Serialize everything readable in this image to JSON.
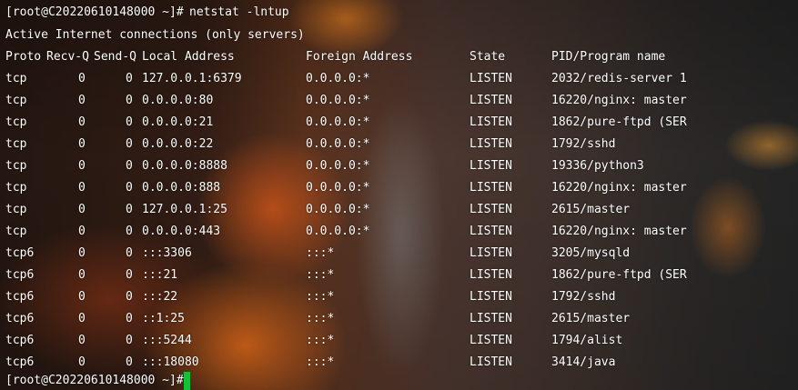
{
  "prompt": "[root@C20220610148000 ~]#",
  "command": "netstat -lntup",
  "heading": "Active Internet connections (only servers)",
  "columns": {
    "proto": "Proto",
    "recvq": "Recv-Q",
    "sendq": "Send-Q",
    "local": "Local Address",
    "foreign": "Foreign Address",
    "state": "State",
    "pid": "PID/Program name"
  },
  "rows": [
    {
      "proto": "tcp",
      "recvq": "0",
      "sendq": "0",
      "local": "127.0.0.1:6379",
      "foreign": "0.0.0.0:*",
      "state": "LISTEN",
      "pid": "2032/redis-server 1"
    },
    {
      "proto": "tcp",
      "recvq": "0",
      "sendq": "0",
      "local": "0.0.0.0:80",
      "foreign": "0.0.0.0:*",
      "state": "LISTEN",
      "pid": "16220/nginx: master"
    },
    {
      "proto": "tcp",
      "recvq": "0",
      "sendq": "0",
      "local": "0.0.0.0:21",
      "foreign": "0.0.0.0:*",
      "state": "LISTEN",
      "pid": "1862/pure-ftpd (SER"
    },
    {
      "proto": "tcp",
      "recvq": "0",
      "sendq": "0",
      "local": "0.0.0.0:22",
      "foreign": "0.0.0.0:*",
      "state": "LISTEN",
      "pid": "1792/sshd"
    },
    {
      "proto": "tcp",
      "recvq": "0",
      "sendq": "0",
      "local": "0.0.0.0:8888",
      "foreign": "0.0.0.0:*",
      "state": "LISTEN",
      "pid": "19336/python3"
    },
    {
      "proto": "tcp",
      "recvq": "0",
      "sendq": "0",
      "local": "0.0.0.0:888",
      "foreign": "0.0.0.0:*",
      "state": "LISTEN",
      "pid": "16220/nginx: master"
    },
    {
      "proto": "tcp",
      "recvq": "0",
      "sendq": "0",
      "local": "127.0.0.1:25",
      "foreign": "0.0.0.0:*",
      "state": "LISTEN",
      "pid": "2615/master"
    },
    {
      "proto": "tcp",
      "recvq": "0",
      "sendq": "0",
      "local": "0.0.0.0:443",
      "foreign": "0.0.0.0:*",
      "state": "LISTEN",
      "pid": "16220/nginx: master"
    },
    {
      "proto": "tcp6",
      "recvq": "0",
      "sendq": "0",
      "local": ":::3306",
      "foreign": ":::*",
      "state": "LISTEN",
      "pid": "3205/mysqld"
    },
    {
      "proto": "tcp6",
      "recvq": "0",
      "sendq": "0",
      "local": ":::21",
      "foreign": ":::*",
      "state": "LISTEN",
      "pid": "1862/pure-ftpd (SER"
    },
    {
      "proto": "tcp6",
      "recvq": "0",
      "sendq": "0",
      "local": ":::22",
      "foreign": ":::*",
      "state": "LISTEN",
      "pid": "1792/sshd"
    },
    {
      "proto": "tcp6",
      "recvq": "0",
      "sendq": "0",
      "local": "::1:25",
      "foreign": ":::*",
      "state": "LISTEN",
      "pid": "2615/master"
    },
    {
      "proto": "tcp6",
      "recvq": "0",
      "sendq": "0",
      "local": ":::5244",
      "foreign": ":::*",
      "state": "LISTEN",
      "pid": "1794/alist"
    },
    {
      "proto": "tcp6",
      "recvq": "0",
      "sendq": "0",
      "local": ":::18080",
      "foreign": ":::*",
      "state": "LISTEN",
      "pid": "3414/java"
    }
  ],
  "colors": {
    "text": "#ffffff",
    "cursor": "#14c23a"
  }
}
